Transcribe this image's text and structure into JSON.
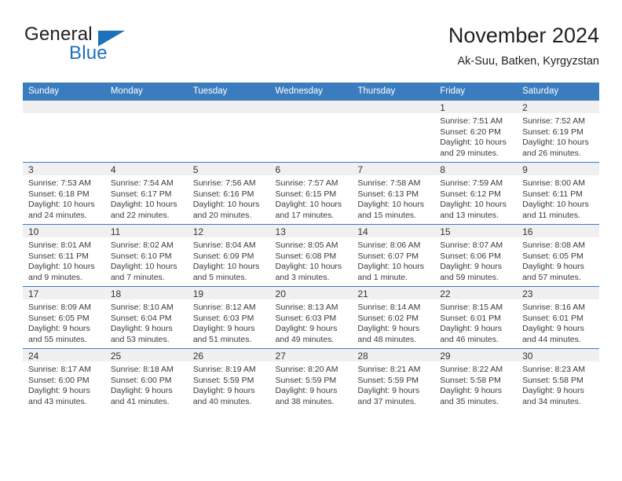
{
  "brand": {
    "name_part1": "General",
    "name_part2": "Blue",
    "logo_icon": "triangle-flag-icon",
    "accent_color": "#1d71b8"
  },
  "header": {
    "title": "November 2024",
    "subtitle": "Ak-Suu, Batken, Kyrgyzstan"
  },
  "theme": {
    "header_row_color": "#3b7cbf",
    "daynum_band_color": "#f0f0f0",
    "text_color": "#3a3a3a"
  },
  "calendar": {
    "weekday_headers": [
      "Sunday",
      "Monday",
      "Tuesday",
      "Wednesday",
      "Thursday",
      "Friday",
      "Saturday"
    ],
    "labels": {
      "sunrise": "Sunrise:",
      "sunset": "Sunset:",
      "daylight": "Daylight:"
    },
    "weeks": [
      [
        {
          "day": "",
          "empty": true
        },
        {
          "day": "",
          "empty": true
        },
        {
          "day": "",
          "empty": true
        },
        {
          "day": "",
          "empty": true
        },
        {
          "day": "",
          "empty": true
        },
        {
          "day": "1",
          "sunrise": "Sunrise: 7:51 AM",
          "sunset": "Sunset: 6:20 PM",
          "daylight": "Daylight: 10 hours and 29 minutes."
        },
        {
          "day": "2",
          "sunrise": "Sunrise: 7:52 AM",
          "sunset": "Sunset: 6:19 PM",
          "daylight": "Daylight: 10 hours and 26 minutes."
        }
      ],
      [
        {
          "day": "3",
          "sunrise": "Sunrise: 7:53 AM",
          "sunset": "Sunset: 6:18 PM",
          "daylight": "Daylight: 10 hours and 24 minutes."
        },
        {
          "day": "4",
          "sunrise": "Sunrise: 7:54 AM",
          "sunset": "Sunset: 6:17 PM",
          "daylight": "Daylight: 10 hours and 22 minutes."
        },
        {
          "day": "5",
          "sunrise": "Sunrise: 7:56 AM",
          "sunset": "Sunset: 6:16 PM",
          "daylight": "Daylight: 10 hours and 20 minutes."
        },
        {
          "day": "6",
          "sunrise": "Sunrise: 7:57 AM",
          "sunset": "Sunset: 6:15 PM",
          "daylight": "Daylight: 10 hours and 17 minutes."
        },
        {
          "day": "7",
          "sunrise": "Sunrise: 7:58 AM",
          "sunset": "Sunset: 6:13 PM",
          "daylight": "Daylight: 10 hours and 15 minutes."
        },
        {
          "day": "8",
          "sunrise": "Sunrise: 7:59 AM",
          "sunset": "Sunset: 6:12 PM",
          "daylight": "Daylight: 10 hours and 13 minutes."
        },
        {
          "day": "9",
          "sunrise": "Sunrise: 8:00 AM",
          "sunset": "Sunset: 6:11 PM",
          "daylight": "Daylight: 10 hours and 11 minutes."
        }
      ],
      [
        {
          "day": "10",
          "sunrise": "Sunrise: 8:01 AM",
          "sunset": "Sunset: 6:11 PM",
          "daylight": "Daylight: 10 hours and 9 minutes."
        },
        {
          "day": "11",
          "sunrise": "Sunrise: 8:02 AM",
          "sunset": "Sunset: 6:10 PM",
          "daylight": "Daylight: 10 hours and 7 minutes."
        },
        {
          "day": "12",
          "sunrise": "Sunrise: 8:04 AM",
          "sunset": "Sunset: 6:09 PM",
          "daylight": "Daylight: 10 hours and 5 minutes."
        },
        {
          "day": "13",
          "sunrise": "Sunrise: 8:05 AM",
          "sunset": "Sunset: 6:08 PM",
          "daylight": "Daylight: 10 hours and 3 minutes."
        },
        {
          "day": "14",
          "sunrise": "Sunrise: 8:06 AM",
          "sunset": "Sunset: 6:07 PM",
          "daylight": "Daylight: 10 hours and 1 minute."
        },
        {
          "day": "15",
          "sunrise": "Sunrise: 8:07 AM",
          "sunset": "Sunset: 6:06 PM",
          "daylight": "Daylight: 9 hours and 59 minutes."
        },
        {
          "day": "16",
          "sunrise": "Sunrise: 8:08 AM",
          "sunset": "Sunset: 6:05 PM",
          "daylight": "Daylight: 9 hours and 57 minutes."
        }
      ],
      [
        {
          "day": "17",
          "sunrise": "Sunrise: 8:09 AM",
          "sunset": "Sunset: 6:05 PM",
          "daylight": "Daylight: 9 hours and 55 minutes."
        },
        {
          "day": "18",
          "sunrise": "Sunrise: 8:10 AM",
          "sunset": "Sunset: 6:04 PM",
          "daylight": "Daylight: 9 hours and 53 minutes."
        },
        {
          "day": "19",
          "sunrise": "Sunrise: 8:12 AM",
          "sunset": "Sunset: 6:03 PM",
          "daylight": "Daylight: 9 hours and 51 minutes."
        },
        {
          "day": "20",
          "sunrise": "Sunrise: 8:13 AM",
          "sunset": "Sunset: 6:03 PM",
          "daylight": "Daylight: 9 hours and 49 minutes."
        },
        {
          "day": "21",
          "sunrise": "Sunrise: 8:14 AM",
          "sunset": "Sunset: 6:02 PM",
          "daylight": "Daylight: 9 hours and 48 minutes."
        },
        {
          "day": "22",
          "sunrise": "Sunrise: 8:15 AM",
          "sunset": "Sunset: 6:01 PM",
          "daylight": "Daylight: 9 hours and 46 minutes."
        },
        {
          "day": "23",
          "sunrise": "Sunrise: 8:16 AM",
          "sunset": "Sunset: 6:01 PM",
          "daylight": "Daylight: 9 hours and 44 minutes."
        }
      ],
      [
        {
          "day": "24",
          "sunrise": "Sunrise: 8:17 AM",
          "sunset": "Sunset: 6:00 PM",
          "daylight": "Daylight: 9 hours and 43 minutes."
        },
        {
          "day": "25",
          "sunrise": "Sunrise: 8:18 AM",
          "sunset": "Sunset: 6:00 PM",
          "daylight": "Daylight: 9 hours and 41 minutes."
        },
        {
          "day": "26",
          "sunrise": "Sunrise: 8:19 AM",
          "sunset": "Sunset: 5:59 PM",
          "daylight": "Daylight: 9 hours and 40 minutes."
        },
        {
          "day": "27",
          "sunrise": "Sunrise: 8:20 AM",
          "sunset": "Sunset: 5:59 PM",
          "daylight": "Daylight: 9 hours and 38 minutes."
        },
        {
          "day": "28",
          "sunrise": "Sunrise: 8:21 AM",
          "sunset": "Sunset: 5:59 PM",
          "daylight": "Daylight: 9 hours and 37 minutes."
        },
        {
          "day": "29",
          "sunrise": "Sunrise: 8:22 AM",
          "sunset": "Sunset: 5:58 PM",
          "daylight": "Daylight: 9 hours and 35 minutes."
        },
        {
          "day": "30",
          "sunrise": "Sunrise: 8:23 AM",
          "sunset": "Sunset: 5:58 PM",
          "daylight": "Daylight: 9 hours and 34 minutes."
        }
      ]
    ]
  }
}
